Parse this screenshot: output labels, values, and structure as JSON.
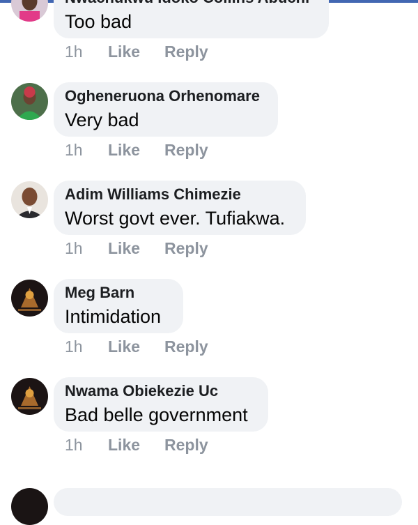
{
  "comments": [
    {
      "author": "Nwachukwu Idoko Collins Abuchi",
      "text": "Too bad",
      "time": "1h",
      "like_label": "Like",
      "reply_label": "Reply",
      "avatar": "man-portrait-avatar"
    },
    {
      "author": "Ogheneruona Orhenomare",
      "text": "Very bad",
      "time": "1h",
      "like_label": "Like",
      "reply_label": "Reply",
      "avatar": "woman-green-portrait-avatar"
    },
    {
      "author": "Adim Williams Chimezie",
      "text": "Worst govt ever. Tufiakwa.",
      "time": "1h",
      "like_label": "Like",
      "reply_label": "Reply",
      "avatar": "man-suit-portrait-avatar"
    },
    {
      "author": "Meg Barn",
      "text": "Intimidation",
      "time": "1h",
      "like_label": "Like",
      "reply_label": "Reply",
      "avatar": "dark-graphic-avatar"
    },
    {
      "author": "Nwama Obiekezie Uc",
      "text": "Bad belle government",
      "time": "1h",
      "like_label": "Like",
      "reply_label": "Reply",
      "avatar": "dark-graphic-avatar"
    }
  ],
  "colors": {
    "bubble": "#f0f2f5",
    "meta": "#8d949e",
    "accent": "#4267b2"
  }
}
